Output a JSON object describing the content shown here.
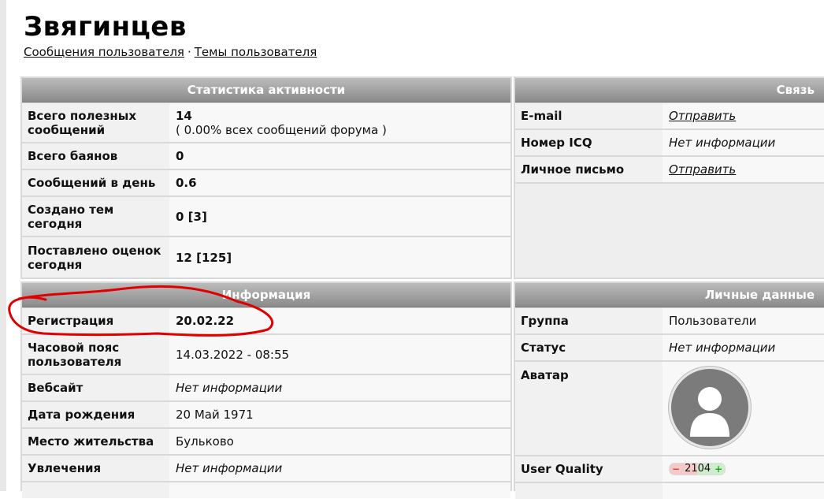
{
  "profile": {
    "username": "Звягинцев",
    "links": [
      "Сообщения пользователя",
      "Темы пользователя"
    ],
    "separator": "·"
  },
  "activity": {
    "title": "Статистика активности",
    "total_useful_label": "Всего полезных сообщений",
    "total_useful_value": "14",
    "total_useful_percent": "( 0.00% всех сообщений форума )",
    "bayan_label": "Всего баянов",
    "bayan_value": "0",
    "per_day_label": "Сообщений в день",
    "per_day_value": "0.6",
    "topics_today_label": "Создано тем сегодня",
    "topics_today_value": "0 [3]",
    "ratings_today_label": "Поставлено оценок сегодня",
    "ratings_today_value": "12 [125]"
  },
  "contact": {
    "title": "Связь",
    "email_label": "E-mail",
    "email_value": "Отправить",
    "icq_label": "Номер ICQ",
    "icq_value": "Нет информации",
    "pm_label": "Личное письмо",
    "pm_value": "Отправить"
  },
  "info": {
    "title": "Информация",
    "reg_label": "Регистрация",
    "reg_value": "20.02.22",
    "tz_label": "Часовой пояс пользователя",
    "tz_value": "14.03.2022 - 08:55",
    "site_label": "Вебсайт",
    "site_value": "Нет информации",
    "birth_label": "Дата рождения",
    "birth_value": "20 Май 1971",
    "city_label": "Место жительства",
    "city_value": "Бульково",
    "hobby_label": "Увлечения",
    "hobby_value": "Нет информации"
  },
  "personal": {
    "title": "Личные данные",
    "group_label": "Группа",
    "group_value": "Пользователи",
    "status_label": "Статус",
    "status_value": "Нет информации",
    "avatar_label": "Аватар",
    "quality_label": "User Quality",
    "quality_minus": "−",
    "quality_value": "2104",
    "quality_plus": "+"
  },
  "colors": {
    "header_gradient_top": "#bcbcbc",
    "header_gradient_bottom": "#8a8a8a",
    "annotation": "#e00000"
  },
  "icons": [
    "avatar-placeholder-icon",
    "minus-icon",
    "plus-icon"
  ]
}
